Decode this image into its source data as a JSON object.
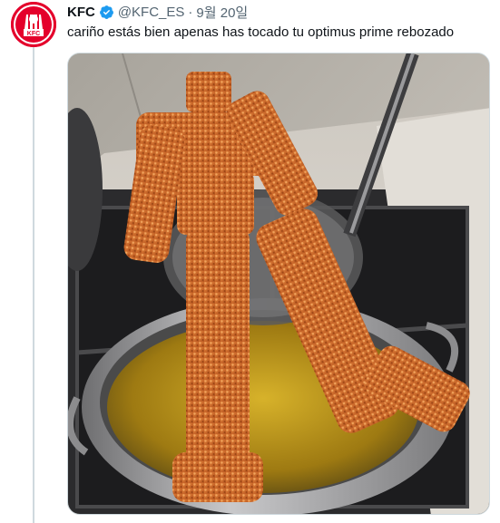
{
  "tweet": {
    "author_name": "KFC",
    "handle": "@KFC_ES",
    "separator": "·",
    "date": "9월 20일",
    "text": "cariño estás bien apenas has tocado tu optimus prime rebozado",
    "avatar_logo_text": "KFC",
    "verified": true
  },
  "colors": {
    "brand_red": "#e4002b",
    "verified_blue": "#1d9bf0",
    "secondary_text": "#536471"
  },
  "media": {
    "alt_icon": "photo-fried-robot"
  }
}
